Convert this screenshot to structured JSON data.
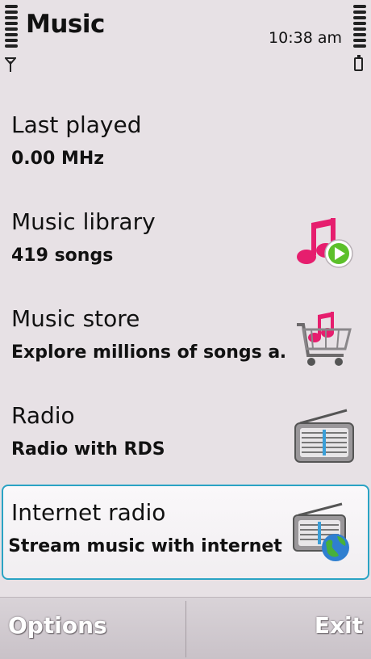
{
  "app": {
    "title": "Music"
  },
  "status": {
    "time": "10:38 am"
  },
  "items": [
    {
      "title": "Last played",
      "subtitle": "0.00 MHz",
      "icon": "none"
    },
    {
      "title": "Music library",
      "subtitle": "419 songs",
      "icon": "music-note-play-icon"
    },
    {
      "title": "Music store",
      "subtitle": "Explore millions of songs a…",
      "icon": "music-cart-icon"
    },
    {
      "title": "Radio",
      "subtitle": "Radio with RDS",
      "icon": "radio-icon"
    },
    {
      "title": "Internet radio",
      "subtitle": "Stream music with internet r",
      "icon": "internet-radio-icon"
    }
  ],
  "softkeys": {
    "left": "Options",
    "right": "Exit"
  },
  "colors": {
    "background": "#e7e1e5",
    "accent": "#e61e6e",
    "highlight": "#2aa3c4"
  }
}
